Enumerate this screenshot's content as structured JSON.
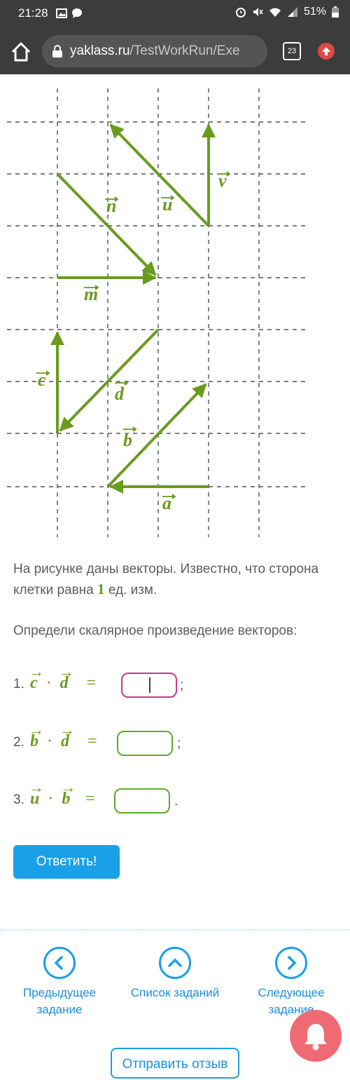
{
  "status": {
    "time": "21:28",
    "battery": "51%"
  },
  "browser": {
    "url_domain": "yaklass.ru",
    "url_path": "/TestWorkRun/Exe",
    "tab_count": "23"
  },
  "figure": {
    "labels": {
      "n": "n",
      "u": "u",
      "v": "v",
      "m": "m",
      "c": "c",
      "d": "d",
      "b": "b",
      "a": "a"
    },
    "colors": {
      "vector": "#6a9b1f",
      "grid": "#505050"
    }
  },
  "text": {
    "intro_1": "На рисунке даны векторы. Известно, что сторона клетки равна",
    "intro_num": "1",
    "intro_2": "ед. изм.",
    "task": "Определи скалярное произведение векторов:"
  },
  "questions": [
    {
      "index": "1.",
      "left": "c",
      "right": "d",
      "punct": ";"
    },
    {
      "index": "2.",
      "left": "b",
      "right": "d",
      "punct": ";"
    },
    {
      "index": "3.",
      "left": "u",
      "right": "b",
      "punct": "."
    }
  ],
  "symbols": {
    "dot": "·",
    "eq": "="
  },
  "buttons": {
    "answer": "Ответить!",
    "feedback": "Отправить отзыв"
  },
  "nav": {
    "prev": "Предыдущее задание",
    "list": "Список заданий",
    "next": "Следующее задание"
  }
}
